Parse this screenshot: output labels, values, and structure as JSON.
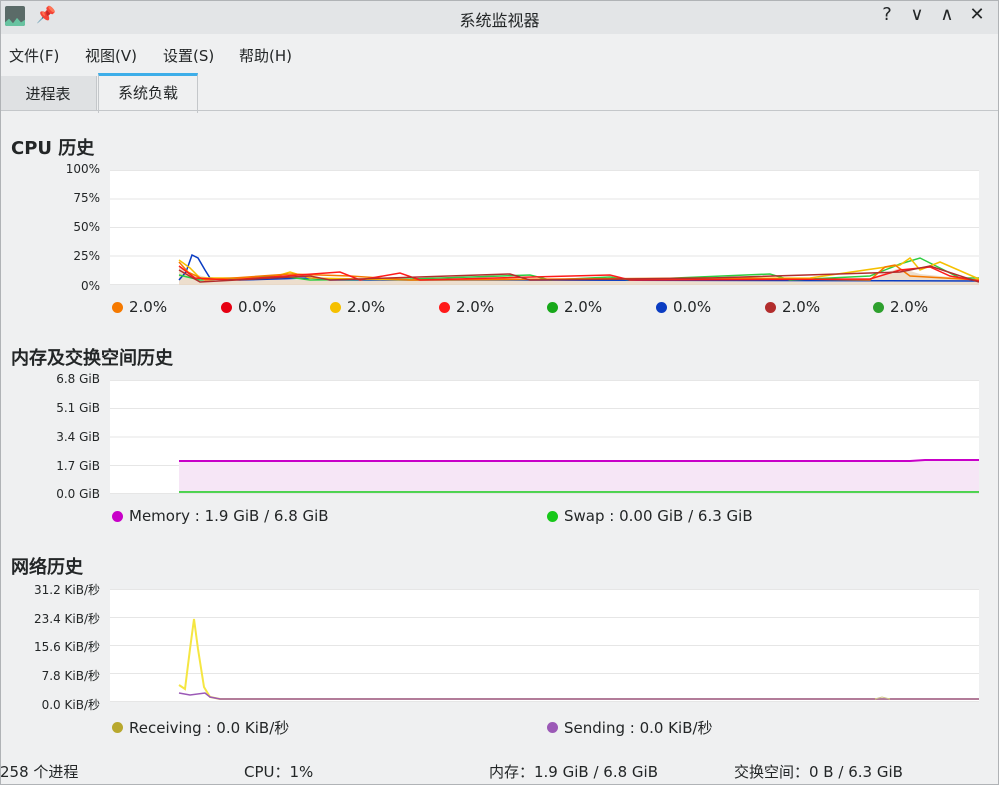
{
  "window": {
    "title": "系统监视器",
    "buttons": {
      "help": "?",
      "minimize": "∨",
      "maximize": "∧",
      "close": "✕"
    }
  },
  "menubar": [
    "文件(F)",
    "视图(V)",
    "设置(S)",
    "帮助(H)"
  ],
  "tabs": [
    "进程表",
    "系统负载"
  ],
  "active_tab": "系统负载",
  "cpu": {
    "title": "CPU 历史",
    "y_ticks": [
      "100%",
      "75%",
      "50%",
      "25%",
      "0%"
    ],
    "legend": [
      {
        "value": "2.0%",
        "color": "#f57900"
      },
      {
        "value": "0.0%",
        "color": "#e60012"
      },
      {
        "value": "2.0%",
        "color": "#f5c000"
      },
      {
        "value": "2.0%",
        "color": "#ff1a1a"
      },
      {
        "value": "2.0%",
        "color": "#17a81a"
      },
      {
        "value": "0.0%",
        "color": "#0a3cc2"
      },
      {
        "value": "2.0%",
        "color": "#b22d2d"
      },
      {
        "value": "2.0%",
        "color": "#2ea02e"
      }
    ]
  },
  "memory": {
    "title": "内存及交换空间历史",
    "y_ticks": [
      "6.8 GiB",
      "5.1 GiB",
      "3.4 GiB",
      "1.7 GiB",
      "0.0 GiB"
    ],
    "legend": [
      {
        "label": "Memory : 1.9 GiB / 6.8 GiB",
        "color": "#c800c8"
      },
      {
        "label": "Swap : 0.00 GiB / 6.3 GiB",
        "color": "#17c81a"
      }
    ]
  },
  "network": {
    "title": "网络历史",
    "y_ticks": [
      "31.2 KiB/秒",
      "23.4 KiB/秒",
      "15.6 KiB/秒",
      "7.8 KiB/秒",
      "0.0 KiB/秒"
    ],
    "legend": [
      {
        "label": "Receiving : 0.0 KiB/秒",
        "color": "#b8a82e"
      },
      {
        "label": "Sending : 0.0 KiB/秒",
        "color": "#9b59b6"
      }
    ]
  },
  "statusbar": {
    "processes": "258 个进程",
    "cpu": "CPU：1%",
    "memory": "内存：1.9 GiB / 6.8 GiB",
    "swap": "交换空间：0 B / 6.3 GiB"
  }
}
